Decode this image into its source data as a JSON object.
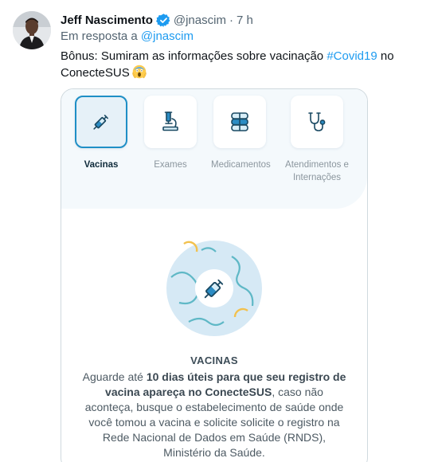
{
  "tweet": {
    "display_name": "Jeff Nascimento",
    "handle": "@jnascim",
    "separator": "·",
    "time": "7 h",
    "reply_prefix": "Em resposta a",
    "reply_to": "@jnascim",
    "text_before": "Bônus: Sumiram as informações sobre vacinação ",
    "hashtag": "#Covid19",
    "text_after": " no ConecteSUS",
    "emoji": "face-screaming-in-fear",
    "verified_icon": "verified-badge-icon"
  },
  "card": {
    "tabs": [
      {
        "label": "Vacinas",
        "icon": "syringe-icon",
        "active": true
      },
      {
        "label": "Exames",
        "icon": "microscope-icon",
        "active": false
      },
      {
        "label": "Medicamentos",
        "icon": "pill-bottle-icon",
        "active": false
      },
      {
        "label": "Atendimentos e Internações",
        "icon": "stethoscope-icon",
        "active": false
      }
    ],
    "section_title": "VACINAS",
    "body_part1": "Aguarde até ",
    "body_bold": "10 dias úteis para que seu registro de vacina apareça no ConecteSUS",
    "body_part2": ", caso não aconteça, busque o estabelecimento de saúde onde você tomou a vacina e solicite solicite o registro na Rede Nacional de Dados em Saúde (RNDS), Ministério da Saúde."
  },
  "colors": {
    "link": "#1d9bf0",
    "active_tab_border": "#1f8fc6",
    "panel_bg": "#f4f9fc"
  }
}
